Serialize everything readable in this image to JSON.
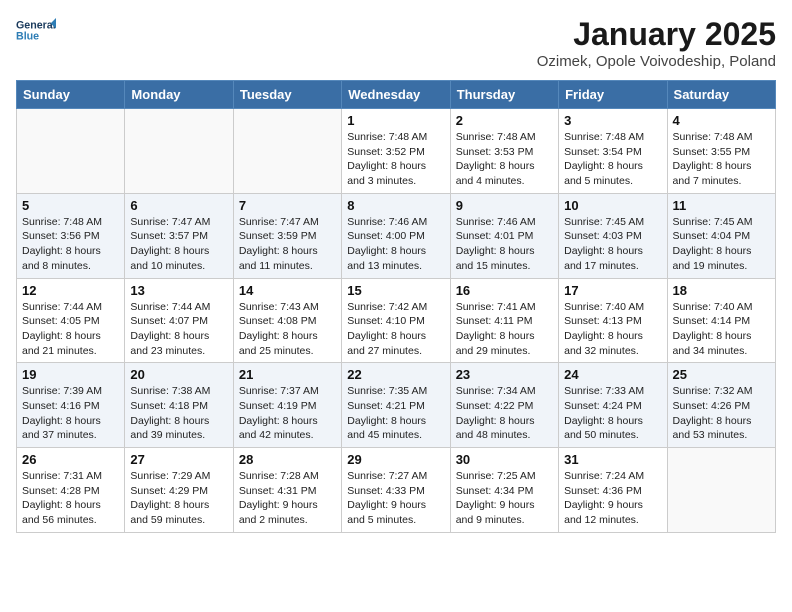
{
  "header": {
    "logo_line1": "General",
    "logo_line2": "Blue",
    "month": "January 2025",
    "location": "Ozimek, Opole Voivodeship, Poland"
  },
  "weekdays": [
    "Sunday",
    "Monday",
    "Tuesday",
    "Wednesday",
    "Thursday",
    "Friday",
    "Saturday"
  ],
  "weeks": [
    [
      {
        "day": "",
        "info": ""
      },
      {
        "day": "",
        "info": ""
      },
      {
        "day": "",
        "info": ""
      },
      {
        "day": "1",
        "info": "Sunrise: 7:48 AM\nSunset: 3:52 PM\nDaylight: 8 hours and 3 minutes."
      },
      {
        "day": "2",
        "info": "Sunrise: 7:48 AM\nSunset: 3:53 PM\nDaylight: 8 hours and 4 minutes."
      },
      {
        "day": "3",
        "info": "Sunrise: 7:48 AM\nSunset: 3:54 PM\nDaylight: 8 hours and 5 minutes."
      },
      {
        "day": "4",
        "info": "Sunrise: 7:48 AM\nSunset: 3:55 PM\nDaylight: 8 hours and 7 minutes."
      }
    ],
    [
      {
        "day": "5",
        "info": "Sunrise: 7:48 AM\nSunset: 3:56 PM\nDaylight: 8 hours and 8 minutes."
      },
      {
        "day": "6",
        "info": "Sunrise: 7:47 AM\nSunset: 3:57 PM\nDaylight: 8 hours and 10 minutes."
      },
      {
        "day": "7",
        "info": "Sunrise: 7:47 AM\nSunset: 3:59 PM\nDaylight: 8 hours and 11 minutes."
      },
      {
        "day": "8",
        "info": "Sunrise: 7:46 AM\nSunset: 4:00 PM\nDaylight: 8 hours and 13 minutes."
      },
      {
        "day": "9",
        "info": "Sunrise: 7:46 AM\nSunset: 4:01 PM\nDaylight: 8 hours and 15 minutes."
      },
      {
        "day": "10",
        "info": "Sunrise: 7:45 AM\nSunset: 4:03 PM\nDaylight: 8 hours and 17 minutes."
      },
      {
        "day": "11",
        "info": "Sunrise: 7:45 AM\nSunset: 4:04 PM\nDaylight: 8 hours and 19 minutes."
      }
    ],
    [
      {
        "day": "12",
        "info": "Sunrise: 7:44 AM\nSunset: 4:05 PM\nDaylight: 8 hours and 21 minutes."
      },
      {
        "day": "13",
        "info": "Sunrise: 7:44 AM\nSunset: 4:07 PM\nDaylight: 8 hours and 23 minutes."
      },
      {
        "day": "14",
        "info": "Sunrise: 7:43 AM\nSunset: 4:08 PM\nDaylight: 8 hours and 25 minutes."
      },
      {
        "day": "15",
        "info": "Sunrise: 7:42 AM\nSunset: 4:10 PM\nDaylight: 8 hours and 27 minutes."
      },
      {
        "day": "16",
        "info": "Sunrise: 7:41 AM\nSunset: 4:11 PM\nDaylight: 8 hours and 29 minutes."
      },
      {
        "day": "17",
        "info": "Sunrise: 7:40 AM\nSunset: 4:13 PM\nDaylight: 8 hours and 32 minutes."
      },
      {
        "day": "18",
        "info": "Sunrise: 7:40 AM\nSunset: 4:14 PM\nDaylight: 8 hours and 34 minutes."
      }
    ],
    [
      {
        "day": "19",
        "info": "Sunrise: 7:39 AM\nSunset: 4:16 PM\nDaylight: 8 hours and 37 minutes."
      },
      {
        "day": "20",
        "info": "Sunrise: 7:38 AM\nSunset: 4:18 PM\nDaylight: 8 hours and 39 minutes."
      },
      {
        "day": "21",
        "info": "Sunrise: 7:37 AM\nSunset: 4:19 PM\nDaylight: 8 hours and 42 minutes."
      },
      {
        "day": "22",
        "info": "Sunrise: 7:35 AM\nSunset: 4:21 PM\nDaylight: 8 hours and 45 minutes."
      },
      {
        "day": "23",
        "info": "Sunrise: 7:34 AM\nSunset: 4:22 PM\nDaylight: 8 hours and 48 minutes."
      },
      {
        "day": "24",
        "info": "Sunrise: 7:33 AM\nSunset: 4:24 PM\nDaylight: 8 hours and 50 minutes."
      },
      {
        "day": "25",
        "info": "Sunrise: 7:32 AM\nSunset: 4:26 PM\nDaylight: 8 hours and 53 minutes."
      }
    ],
    [
      {
        "day": "26",
        "info": "Sunrise: 7:31 AM\nSunset: 4:28 PM\nDaylight: 8 hours and 56 minutes."
      },
      {
        "day": "27",
        "info": "Sunrise: 7:29 AM\nSunset: 4:29 PM\nDaylight: 8 hours and 59 minutes."
      },
      {
        "day": "28",
        "info": "Sunrise: 7:28 AM\nSunset: 4:31 PM\nDaylight: 9 hours and 2 minutes."
      },
      {
        "day": "29",
        "info": "Sunrise: 7:27 AM\nSunset: 4:33 PM\nDaylight: 9 hours and 5 minutes."
      },
      {
        "day": "30",
        "info": "Sunrise: 7:25 AM\nSunset: 4:34 PM\nDaylight: 9 hours and 9 minutes."
      },
      {
        "day": "31",
        "info": "Sunrise: 7:24 AM\nSunset: 4:36 PM\nDaylight: 9 hours and 12 minutes."
      },
      {
        "day": "",
        "info": ""
      }
    ]
  ]
}
